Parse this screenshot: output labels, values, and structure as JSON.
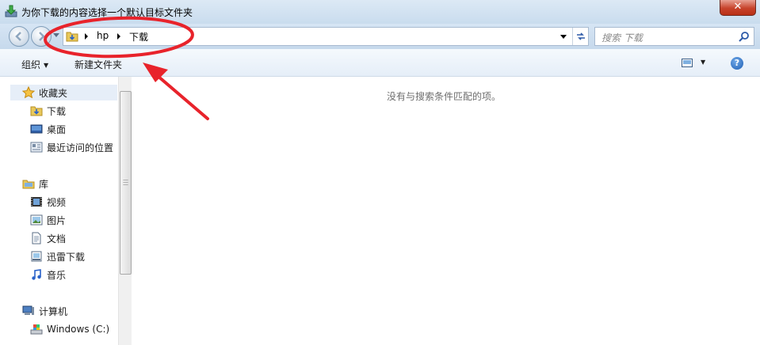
{
  "window": {
    "title": "为你下载的内容选择一个默认目标文件夹",
    "close_label": "✕"
  },
  "address": {
    "crumbs": [
      "hp",
      "下载"
    ]
  },
  "search": {
    "placeholder": "搜索 下载"
  },
  "toolbar": {
    "organize_label": "组织",
    "new_folder_label": "新建文件夹",
    "help_label": "?"
  },
  "nav": {
    "favorites": {
      "label": "收藏夹",
      "items": [
        {
          "label": "下载",
          "icon": "download-folder-icon"
        },
        {
          "label": "桌面",
          "icon": "desktop-icon"
        },
        {
          "label": "最近访问的位置",
          "icon": "recent-places-icon"
        }
      ]
    },
    "libraries": {
      "label": "库",
      "items": [
        {
          "label": "视频",
          "icon": "video-icon"
        },
        {
          "label": "图片",
          "icon": "picture-icon"
        },
        {
          "label": "文档",
          "icon": "document-icon"
        },
        {
          "label": "迅雷下载",
          "icon": "thunder-download-icon"
        },
        {
          "label": "音乐",
          "icon": "music-icon"
        }
      ]
    },
    "computer": {
      "label": "计算机",
      "items": [
        {
          "label": "Windows  (C:)",
          "icon": "drive-icon"
        }
      ]
    }
  },
  "content": {
    "empty_message": "没有与搜索条件匹配的项。"
  },
  "colors": {
    "annotation_red": "#e8232b",
    "close_button": "#c7432b"
  }
}
